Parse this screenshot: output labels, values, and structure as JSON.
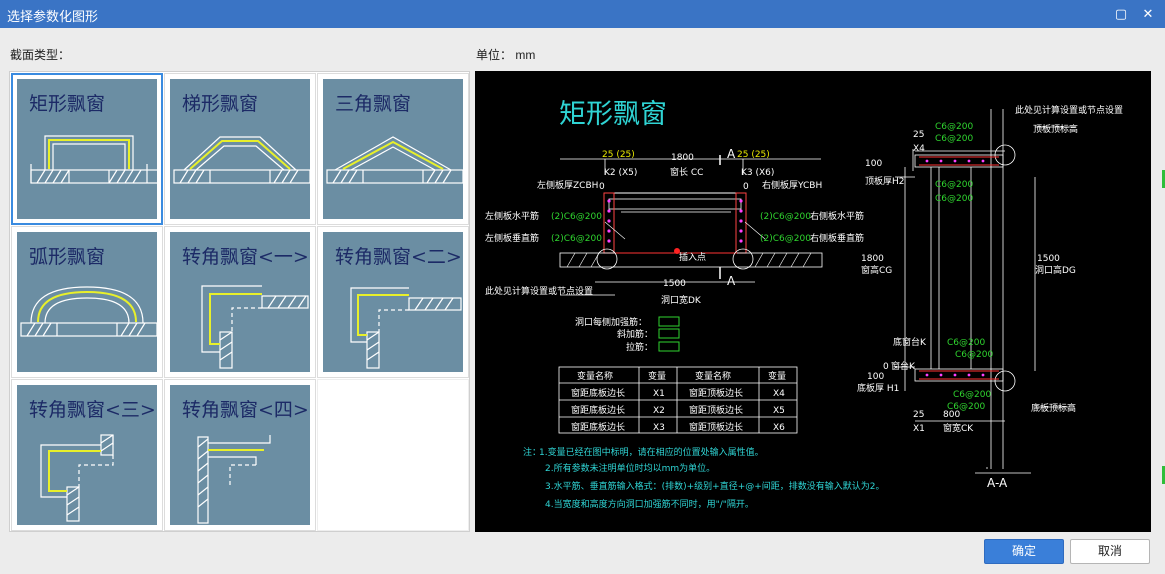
{
  "window": {
    "title": "选择参数化图形",
    "close_glyph": "✕",
    "max_glyph": "▢"
  },
  "labels": {
    "section_type": "截面类型：",
    "unit": "单位：  mm"
  },
  "tiles": [
    {
      "label": "矩形飘窗",
      "selected": true
    },
    {
      "label": "梯形飘窗",
      "selected": false
    },
    {
      "label": "三角飘窗",
      "selected": false
    },
    {
      "label": "弧形飘窗",
      "selected": false
    },
    {
      "label": "转角飘窗<一>",
      "selected": false
    },
    {
      "label": "转角飘窗<二>",
      "selected": false
    },
    {
      "label": "转角飘窗<三>",
      "selected": false
    },
    {
      "label": "转角飘窗<四>",
      "selected": false
    }
  ],
  "preview": {
    "title": "矩形飘窗",
    "top_labels": {
      "a_mark": "A",
      "a_mark2": "A",
      "left_dim": "25 (25)",
      "mid_dim": "1800",
      "right_dim": "25 (25)",
      "k2x5": "K2 (X5)",
      "window_len": "窗长 CC",
      "k3x6": "K3 (X6)",
      "k0": "0",
      "k0r": "0"
    },
    "left_labels": {
      "left_thick": "左侧板厚ZCBH",
      "right_thick": "右侧板厚YCBH",
      "left_horiz": "左侧板水平筋",
      "left_vert": "左侧板垂直筋",
      "left_horiz_val": "(2)C6@200",
      "left_vert_val": "(2)C6@200",
      "right_horiz": "右侧板水平筋",
      "right_vert": "右侧板垂直筋",
      "right_horiz_val": "(2)C6@200",
      "right_vert_val": "(2)C6@200",
      "insert_point": "插入点",
      "dim_1500": "1500",
      "opening_width": "洞口宽DK",
      "calc_note": "此处见计算设置或节点设置",
      "rebar_edge": "洞口每侧加强筋：",
      "rebar_diag": "斜加筋：",
      "rebar_tie": "拉筋："
    },
    "table": {
      "headers": [
        "变量名称",
        "变量",
        "变量名称",
        "变量"
      ],
      "rows": [
        [
          "窗距底板边长",
          "X1",
          "窗距顶板边长",
          "X4"
        ],
        [
          "窗距底板边长",
          "X2",
          "窗距顶板边长",
          "X5"
        ],
        [
          "窗距底板边长",
          "X3",
          "窗距顶板边长",
          "X6"
        ]
      ]
    },
    "notes": {
      "prefix": "注：",
      "lines": [
        "1.变量已经在图中标明，请在相应的位置处输入属性值。",
        "2.所有参数未注明单位时均以mm为单位。",
        "3.水平筋、垂直筋输入格式：(排数)+级别+直径+@+间距，排数没有输入默认为2。",
        "4.当宽度和高度方向洞口加强筋不同时，用\"/\"隔开。"
      ]
    },
    "section": {
      "calc_note": "此处见计算设置或节点设置",
      "top_plate_elev": "顶板顶标高",
      "d25_top": "25",
      "x4": "X4",
      "c6_1": "C6@200",
      "c6_2": "C6@200",
      "c6_3": "C6@200",
      "c6_4": "C6@200",
      "d100_top": "100",
      "top_thick": "顶板厚H2",
      "d1800": "1800",
      "win_height": "窗高CG",
      "d1500": "1500",
      "open_height": "洞口高DG",
      "bottom_note1": "底窗台K",
      "bottom_note2": "窗台K",
      "c6_5": "C6@200",
      "c6_6": "C6@200",
      "d0": "0",
      "d100_bot": "100",
      "bot_thick": "底板厚 H1",
      "c6_7": "C6@200",
      "c6_8": "C6@200",
      "bot_plate_elev": "底板顶标高",
      "d25_bot": "25",
      "d800": "800",
      "x1": "X1",
      "win_width": "窗宽CK",
      "cut": "A-A"
    }
  },
  "buttons": {
    "ok": "确定",
    "cancel": "取消"
  }
}
